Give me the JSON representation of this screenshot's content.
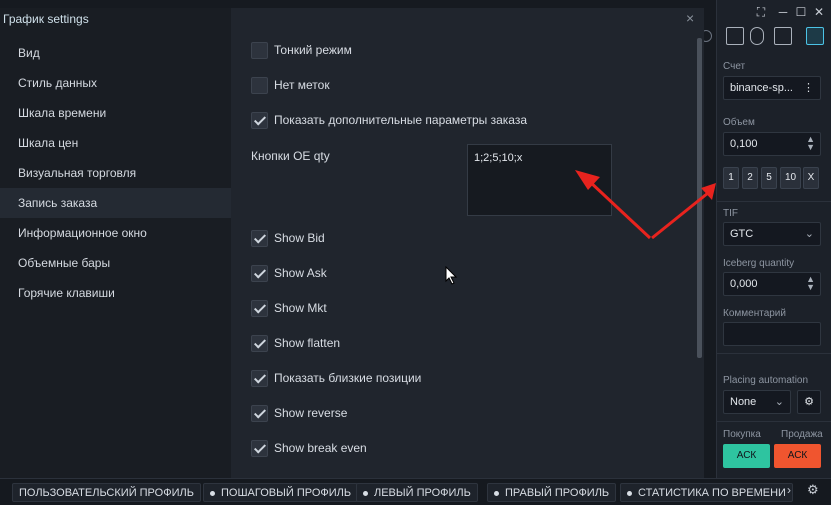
{
  "dialog": {
    "title": "График settings",
    "close": "×",
    "sidebar": [
      {
        "label": "Вид"
      },
      {
        "label": "Стиль данных"
      },
      {
        "label": "Шкала времени"
      },
      {
        "label": "Шкала цен"
      },
      {
        "label": "Визуальная торговля"
      },
      {
        "label": "Запись заказа",
        "active": true
      },
      {
        "label": "Информационное окно"
      },
      {
        "label": "Объемные бары"
      },
      {
        "label": "Горячие клавиши"
      }
    ],
    "options_top": [
      {
        "label": "Тонкий режим",
        "checked": false
      },
      {
        "label": "Нет меток",
        "checked": false
      },
      {
        "label": "Показать дополнительные параметры заказа",
        "checked": true
      }
    ],
    "oe_qty": {
      "label": "Кнопки OE qty",
      "value": "1;2;5;10;x"
    },
    "options_bottom": [
      {
        "label": "Show Bid",
        "checked": true
      },
      {
        "label": "Show Ask",
        "checked": true
      },
      {
        "label": "Show Mkt",
        "checked": true
      },
      {
        "label": "Show flatten",
        "checked": true
      },
      {
        "label": "Показать близкие позиции",
        "checked": true
      },
      {
        "label": "Show reverse",
        "checked": true
      },
      {
        "label": "Show break even",
        "checked": true
      }
    ]
  },
  "right_panel": {
    "account_label": "Счет",
    "account_value": "binance-sp...",
    "volume_label": "Объем",
    "volume_value": "0,100",
    "qty_buttons": [
      "1",
      "2",
      "5",
      "10",
      "X"
    ],
    "tif_label": "TIF",
    "tif_value": "GTC",
    "iceberg_label": "Iceberg quantity",
    "iceberg_value": "0,000",
    "comment_label": "Комментарий",
    "placing_label": "Placing automation",
    "placing_value": "None",
    "buy_label": "Покупка",
    "sell_label": "Продажа",
    "buy_button": "АСК",
    "sell_button": "АСК"
  },
  "bottom_tabs": [
    "ПОЛЬЗОВАТЕЛЬСКИЙ ПРОФИЛЬ",
    "ПОШАГОВЫЙ ПРОФИЛЬ",
    "ЛЕВЫЙ ПРОФИЛЬ",
    "ПРАВЫЙ ПРОФИЛЬ",
    "СТАТИСТИКА ПО ВРЕМЕНИ"
  ],
  "colors": {
    "buy": "#2ec4a0",
    "sell": "#f0552f",
    "arrow": "#e8231e"
  }
}
